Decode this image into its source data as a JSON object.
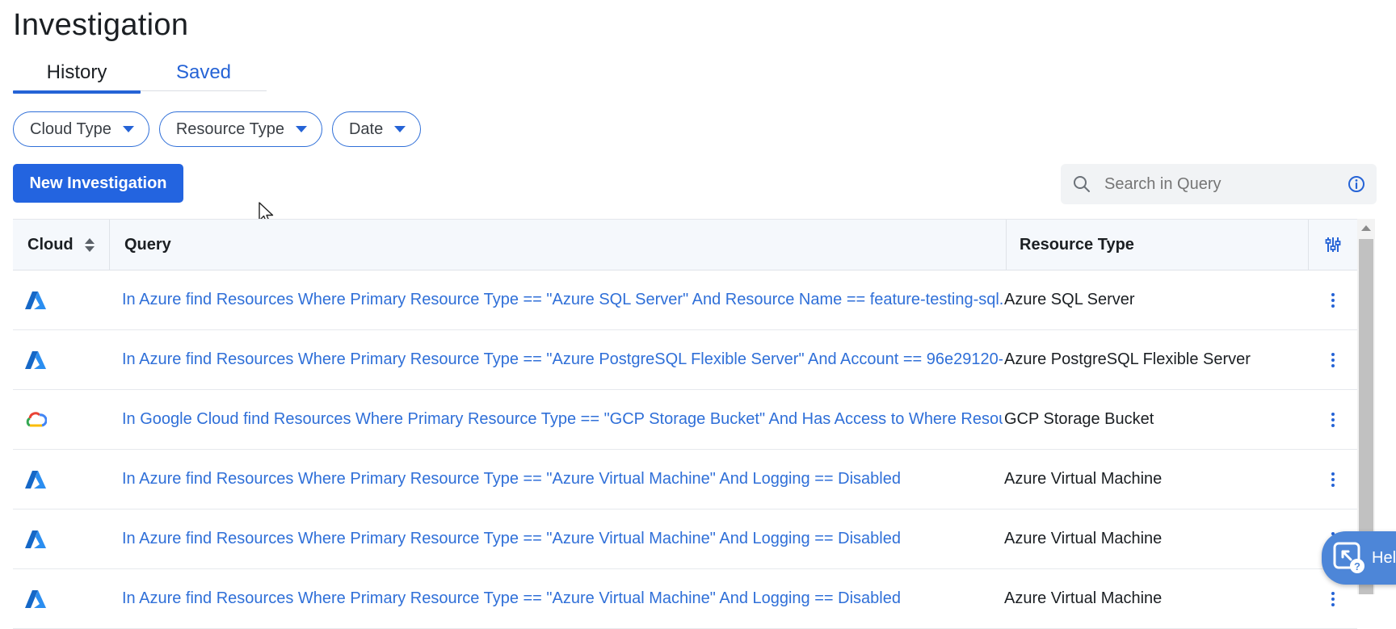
{
  "page": {
    "title": "Investigation"
  },
  "tabs": [
    {
      "label": "History",
      "active": true
    },
    {
      "label": "Saved",
      "active": false
    }
  ],
  "filters": [
    {
      "label": "Cloud Type"
    },
    {
      "label": "Resource Type"
    },
    {
      "label": "Date"
    }
  ],
  "actions": {
    "new_investigation": "New Investigation"
  },
  "search": {
    "placeholder": "Search in Query",
    "value": ""
  },
  "table": {
    "columns": {
      "cloud": "Cloud",
      "query": "Query",
      "resource_type": "Resource Type"
    },
    "rows": [
      {
        "cloud": "azure",
        "query": "In Azure find Resources Where Primary Resource Type == \"Azure SQL Server\" And Resource Name == feature-testing-sql...",
        "resource_type": "Azure SQL Server"
      },
      {
        "cloud": "azure",
        "query": "In Azure find Resources Where Primary Resource Type == \"Azure PostgreSQL Flexible Server\" And Account == 96e29120-...",
        "resource_type": "Azure PostgreSQL Flexible Server"
      },
      {
        "cloud": "gcp",
        "query": "In Google Cloud find Resources Where Primary Resource Type == \"GCP Storage Bucket\" And Has Access to Where Resour...",
        "resource_type": "GCP Storage Bucket"
      },
      {
        "cloud": "azure",
        "query": "In Azure find Resources Where Primary Resource Type == \"Azure Virtual Machine\" And Logging == Disabled",
        "resource_type": "Azure Virtual Machine"
      },
      {
        "cloud": "azure",
        "query": "In Azure find Resources Where Primary Resource Type == \"Azure Virtual Machine\" And Logging == Disabled",
        "resource_type": "Azure Virtual Machine"
      },
      {
        "cloud": "azure",
        "query": "In Azure find Resources Where Primary Resource Type == \"Azure Virtual Machine\" And Logging == Disabled",
        "resource_type": "Azure Virtual Machine"
      }
    ]
  },
  "help": {
    "label": "Help"
  },
  "colors": {
    "accent": "#2563d6",
    "link": "#2f6fd8",
    "header_bg": "#f5f8fc"
  },
  "icons": {
    "azure": "azure-logo-icon",
    "gcp": "google-cloud-logo-icon",
    "sort": "sort-icon",
    "settings": "column-settings-icon",
    "menu": "kebab-menu-icon",
    "search": "search-icon",
    "info": "info-icon"
  }
}
